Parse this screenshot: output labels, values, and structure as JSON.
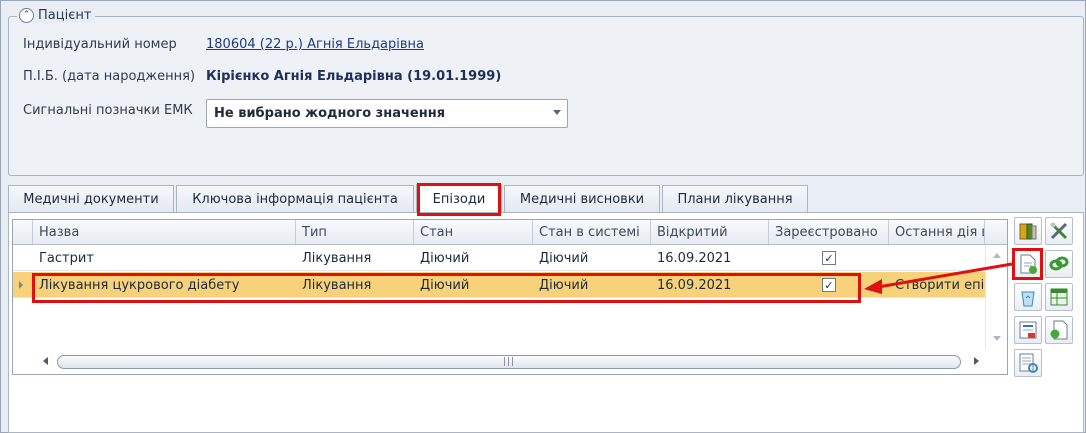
{
  "patient": {
    "title": "Пацієнт",
    "collapse_glyph": "⌃",
    "fields": {
      "id_label": "Індивідуальний номер",
      "id_value": "180604 (22 р.) Агнія Ельдарівна",
      "name_label": "П.І.Б. (дата народження)",
      "name_value": "Кірієнко Агнія Ельдарівна (19.01.1999)",
      "signals_label": "Сигнальні позначки ЕМК",
      "signals_value": "Не вибрано жодного значення"
    }
  },
  "tabs": [
    {
      "label": "Медичні документи"
    },
    {
      "label": "Ключова інформація пацієнта"
    },
    {
      "label": "Епізоди",
      "active": true
    },
    {
      "label": "Медичні висновки"
    },
    {
      "label": "Плани лікування"
    }
  ],
  "grid": {
    "columns": [
      "Назва",
      "Тип",
      "Стан",
      "Стан в системі",
      "Відкритий",
      "Зареєстровано",
      "Остання дія в"
    ],
    "rows": [
      {
        "name": "Гастрит",
        "type": "Лікування",
        "state": "Діючий",
        "system_state": "Діючий",
        "opened": "16.09.2021",
        "registered": true,
        "last_action": ""
      },
      {
        "name": "Лікування цукрового діабету",
        "type": "Лікування",
        "state": "Діючий",
        "system_state": "Діючий",
        "opened": "16.09.2021",
        "registered": true,
        "last_action": "Створити епі",
        "selected": true
      }
    ],
    "check_glyph": "✓",
    "scroll_thumb_glyph": "|||"
  },
  "toolbar": {
    "icons": [
      "folder-icon",
      "tools-icon",
      "new-document-icon",
      "link-icon",
      "recycle-icon",
      "spreadsheet-icon",
      "report-icon",
      "export-document-icon",
      "refresh-list-icon"
    ]
  },
  "colors": {
    "accent_red": "#e01010",
    "selected_row": "#f7d27a",
    "link": "#1d3b80"
  }
}
